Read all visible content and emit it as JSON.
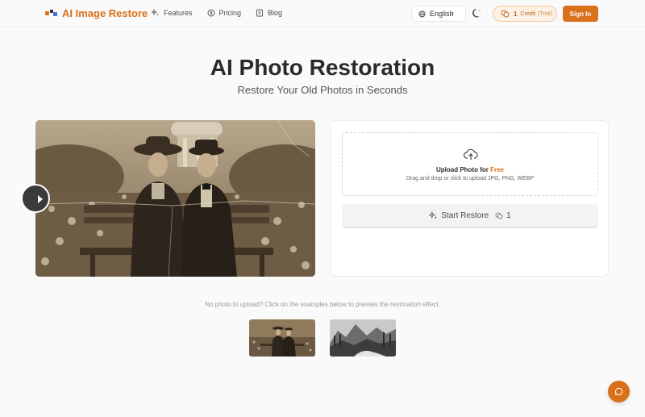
{
  "header": {
    "brand": "AI Image Restore",
    "nav": [
      {
        "label": "Features",
        "icon": "sparkles-icon"
      },
      {
        "label": "Pricing",
        "icon": "coin-icon"
      },
      {
        "label": "Blog",
        "icon": "book-icon"
      }
    ],
    "language": "English",
    "credit_count": "1",
    "credit_label": "Credit",
    "credit_trial": "(Trial)",
    "sign_in": "Sign In"
  },
  "hero": {
    "title": "AI Photo Restoration",
    "subtitle": "Restore Your Old Photos in Seconds"
  },
  "upload": {
    "title": "Upload Photo for",
    "title_highlight": "Free",
    "hint": "Drag and drop or click to upload JPG, PNG, WEBP",
    "start_label": "Start Restore",
    "cost": "1"
  },
  "examples": {
    "note": "No photo to upload? Click on the examples below to preview the restoration effect."
  },
  "colors": {
    "accent": "#d9701a",
    "accent_soft": "#fdf1e5"
  }
}
